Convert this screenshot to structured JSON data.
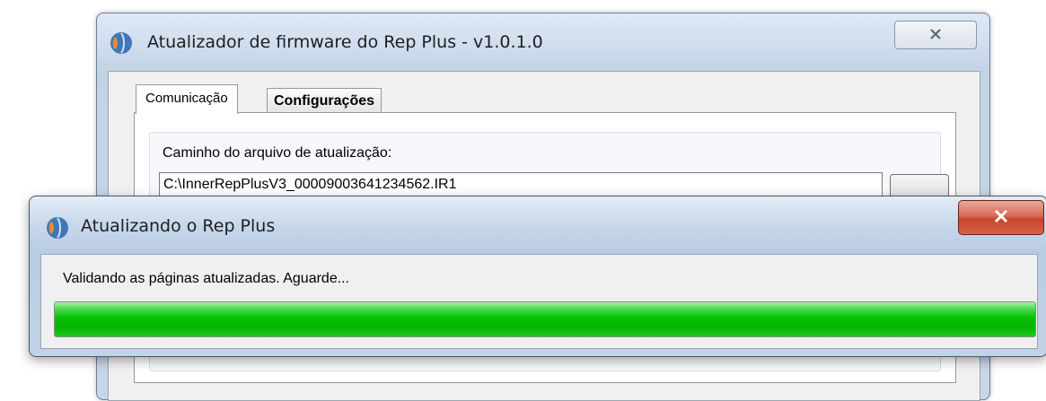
{
  "updater_window": {
    "title": "Atualizador de firmware do Rep Plus  -  v1.0.1.0",
    "close_icon": "close-icon",
    "tabs": [
      {
        "label": "Comunicação",
        "selected": true
      },
      {
        "label": "Configurações",
        "selected": false
      }
    ],
    "path_label": "Caminho do arquivo de atualização:",
    "path_value": "C:\\InnerRepPlusV3_00009003641234562.IR1"
  },
  "progress_dialog": {
    "title": "Atualizando o Rep Plus",
    "status_text": "Validando as páginas atualizadas. Aguarde...",
    "progress_fraction": 1.0,
    "colors": {
      "progress": "#06c106",
      "close_button": "#c7452c"
    }
  }
}
